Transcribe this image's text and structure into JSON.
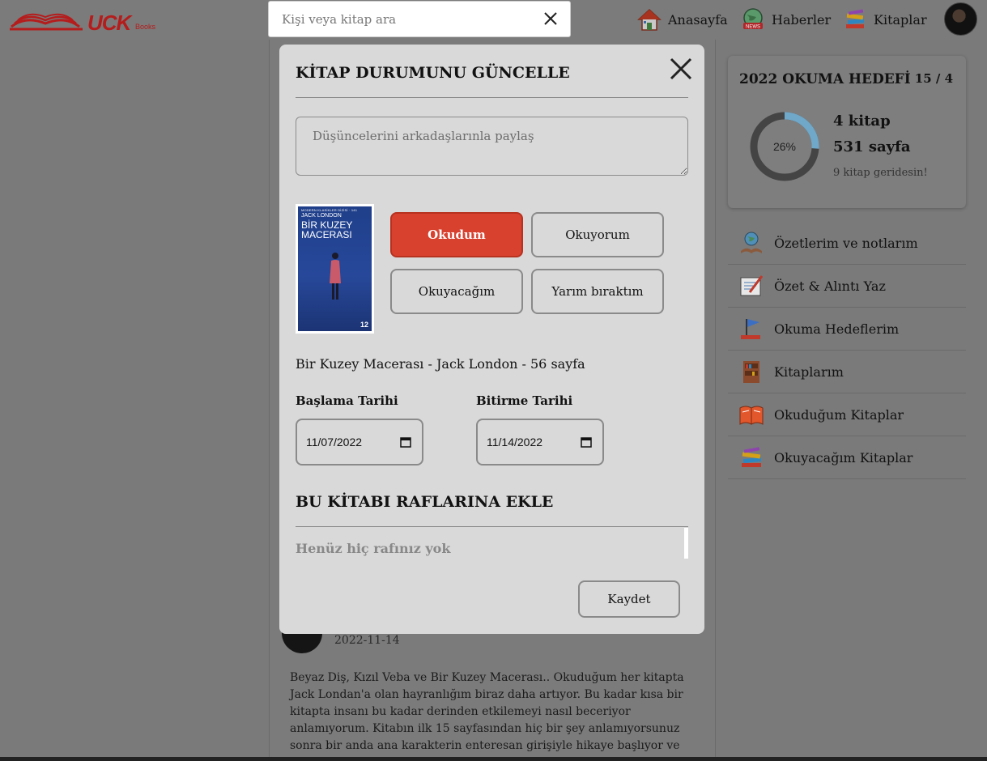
{
  "header": {
    "logo_text": "UCK",
    "logo_sub": "Books",
    "search_placeholder": "Kişi veya kitap ara",
    "nav": [
      {
        "label": "Anasayfa",
        "icon": "home-icon"
      },
      {
        "label": "Haberler",
        "icon": "news-globe-icon"
      },
      {
        "label": "Kitaplar",
        "icon": "book-stack-icon"
      }
    ]
  },
  "modal": {
    "title": "KİTAP DURUMUNU GÜNCELLE",
    "thoughts_placeholder": "Düşüncelerini arkadaşlarınla paylaş",
    "cover": {
      "series": "MODERN KLASİKLER DİZİSİ · 141",
      "author": "JACK LONDON",
      "title": "BİR KUZEY MACERASI",
      "number": "12"
    },
    "status_buttons": [
      {
        "label": "Okudum",
        "active": true
      },
      {
        "label": "Okuyorum",
        "active": false
      },
      {
        "label": "Okuyacağım",
        "active": false
      },
      {
        "label": "Yarım bıraktım",
        "active": false
      }
    ],
    "book_line": "Bir Kuzey Macerası - Jack London - 56 sayfa",
    "start_label": "Başlama Tarihi",
    "start_value": "11/07/2022",
    "end_label": "Bitirme Tarihi",
    "end_value": "11/14/2022",
    "shelves_title": "BU KİTABI RAFLARINA EKLE",
    "shelves_empty": "Henüz hiç rafınız yok",
    "save_label": "Kaydet"
  },
  "feed": {
    "post_date": "2022-11-14",
    "post_body": "Beyaz Diş, Kızıl Veba ve Bir Kuzey Macerası.. Okuduğum her kitapta Jack Londan'a olan hayranlığım biraz daha artıyor. Bu kadar kısa bir kitapta insanı bu kadar derinden etkilemeyi nasıl beceriyor anlamıyorum. Kitabın ilk 15 sayfasından hiç bir şey anlamıyorsunuz sonra bir anda ana karakterin enteresan girişiyle hikaye başlıyor ve son cümleye kadar nereye"
  },
  "sidebar": {
    "goal": {
      "title": "2022 OKUMA HEDEFİ",
      "count": "15 / 4",
      "percent_label": "26%",
      "progress": 0.26,
      "books": "4 kitap",
      "pages": "531 sayfa",
      "note": "9 kitap geridesin!"
    },
    "menu": [
      {
        "label": "Özetlerim ve notlarım",
        "icon": "globe-book-icon"
      },
      {
        "label": "Özet & Alıntı Yaz",
        "icon": "notebook-pen-icon"
      },
      {
        "label": "Okuma Hedeflerim",
        "icon": "flag-book-icon"
      },
      {
        "label": "Kitaplarım",
        "icon": "bookshelf-icon"
      },
      {
        "label": "Okuduğum Kitaplar",
        "icon": "open-book-icon"
      },
      {
        "label": "Okuyacağım Kitaplar",
        "icon": "book-stack-icon"
      }
    ]
  },
  "colors": {
    "accent_red": "#d9412f",
    "overlay_gray": "#7b7b7b",
    "modal_bg": "#d9d9d9",
    "progress_blue": "#6fa8c8"
  }
}
